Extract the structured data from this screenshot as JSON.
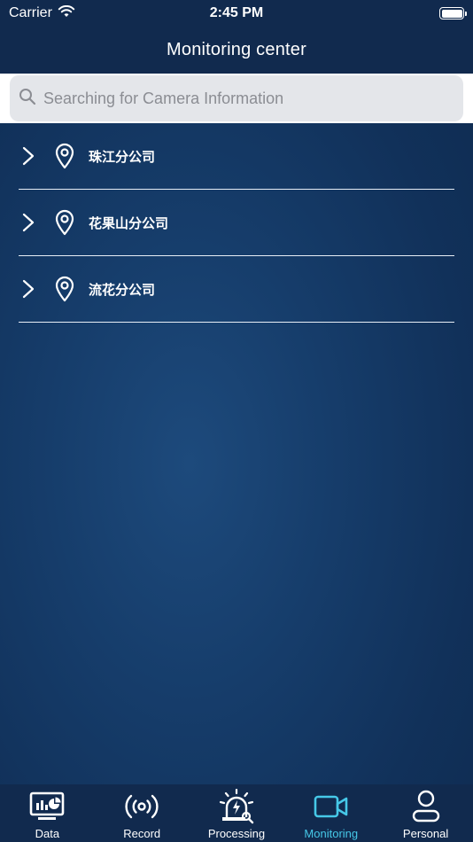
{
  "status_bar": {
    "carrier": "Carrier",
    "time": "2:45 PM"
  },
  "nav": {
    "title": "Monitoring center"
  },
  "search": {
    "placeholder": "Searching for Camera Information"
  },
  "branches": [
    {
      "label": "珠江分公司"
    },
    {
      "label": "花果山分公司"
    },
    {
      "label": "流花分公司"
    }
  ],
  "tabs": [
    {
      "label": "Data",
      "icon": "monitor-chart-icon"
    },
    {
      "label": "Record",
      "icon": "broadcast-icon"
    },
    {
      "label": "Processing",
      "icon": "alarm-light-icon"
    },
    {
      "label": "Monitoring",
      "icon": "video-camera-icon"
    },
    {
      "label": "Personal",
      "icon": "person-icon"
    }
  ],
  "active_tab": "Monitoring",
  "colors": {
    "header_bg": "#112a4e",
    "active_tab": "#46c8e8",
    "search_bg": "#e4e6ea"
  }
}
